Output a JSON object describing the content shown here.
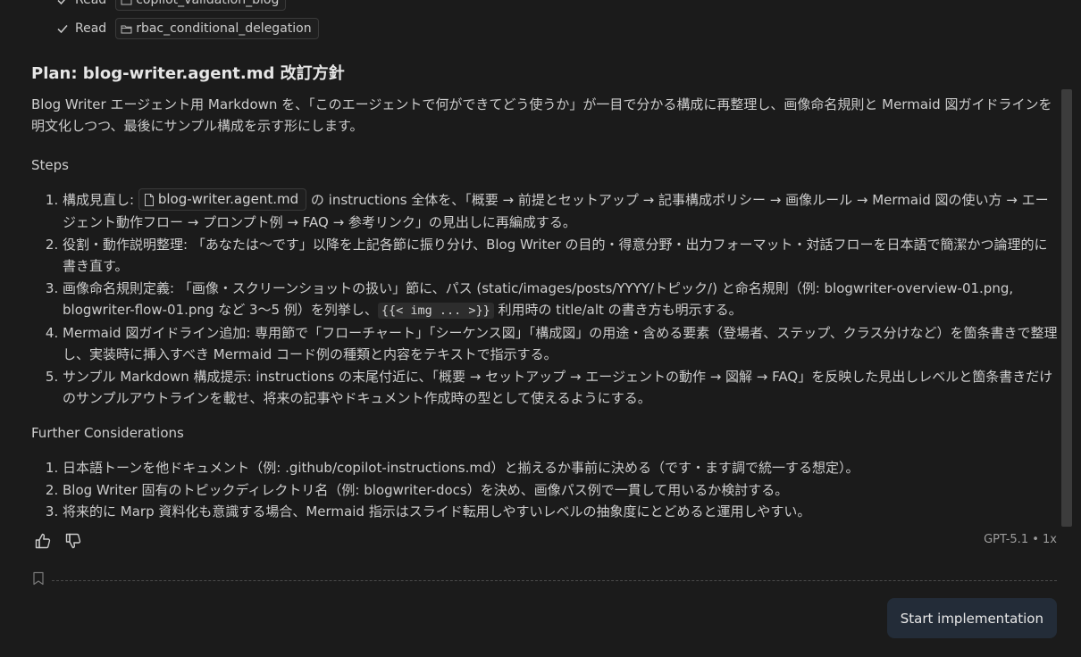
{
  "reads": [
    {
      "label": "Read",
      "file": "copilot_validation_blog"
    },
    {
      "label": "Read",
      "file": "rbac_conditional_delegation"
    }
  ],
  "plan": {
    "title": "Plan: blog-writer.agent.md 改訂方針",
    "intro": "Blog Writer エージェント用 Markdown を、「このエージェントで何ができてどう使うか」が一目で分かる構成に再整理し、画像命名規則と Mermaid 図ガイドラインを明文化しつつ、最後にサンプル構成を示す形にします。",
    "steps_heading": "Steps",
    "steps": [
      {
        "pre": "構成見直し: ",
        "file": "blog-writer.agent.md",
        "post": " の instructions 全体を、「概要 → 前提とセットアップ → 記事構成ポリシー → 画像ルール → Mermaid 図の使い方 → エージェント動作フロー → プロンプト例 → FAQ → 参考リンク」の見出しに再編成する。"
      },
      {
        "text": "役割・動作説明整理: 「あなたは〜です」以降を上記各節に振り分け、Blog Writer の目的・得意分野・出力フォーマット・対話フローを日本語で簡潔かつ論理的に書き直す。"
      },
      {
        "pre": "画像命名規則定義: 「画像・スクリーンショットの扱い」節に、パス (static/images/posts/YYYY/トピック/) と命名規則（例: blogwriter-overview-01.png, blogwriter-flow-01.png など 3〜5 例）を列挙し、",
        "code": "{{< img ... >}}",
        "post": " 利用時の title/alt の書き方も明示する。"
      },
      {
        "text": "Mermaid 図ガイドライン追加: 専用節で「フローチャート」「シーケンス図」「構成図」の用途・含める要素（登場者、ステップ、クラス分けなど）を箇条書きで整理し、実装時に挿入すべき Mermaid コード例の種類と内容をテキストで指示する。"
      },
      {
        "text": "サンプル Markdown 構成提示: instructions の末尾付近に、「概要 → セットアップ → エージェントの動作 → 図解 → FAQ」を反映した見出しレベルと箇条書きだけのサンプルアウトラインを載せ、将来の記事やドキュメント作成時の型として使えるようにする。"
      }
    ],
    "further_heading": "Further Considerations",
    "further": [
      "日本語トーンを他ドキュメント（例: .github/copilot-instructions.md）と揃えるか事前に決める（です・ます調で統一する想定）。",
      "Blog Writer 固有のトピックディレクトリ名（例: blogwriter-docs）を決め、画像パス例で一貫して用いるか検討する。",
      "将来的に Marp 資料化も意識する場合、Mermaid 指示はスライド転用しやすいレベルの抽象度にとどめると運用しやすい。"
    ]
  },
  "footer": {
    "model": "GPT-5.1 • 1x",
    "start_button": "Start implementation"
  },
  "icons": {
    "thumbs_up": "thumbs-up-icon",
    "thumbs_down": "thumbs-down-icon",
    "bookmark": "bookmark-icon",
    "check": "check-icon",
    "folder": "folder-icon",
    "file": "file-icon"
  }
}
